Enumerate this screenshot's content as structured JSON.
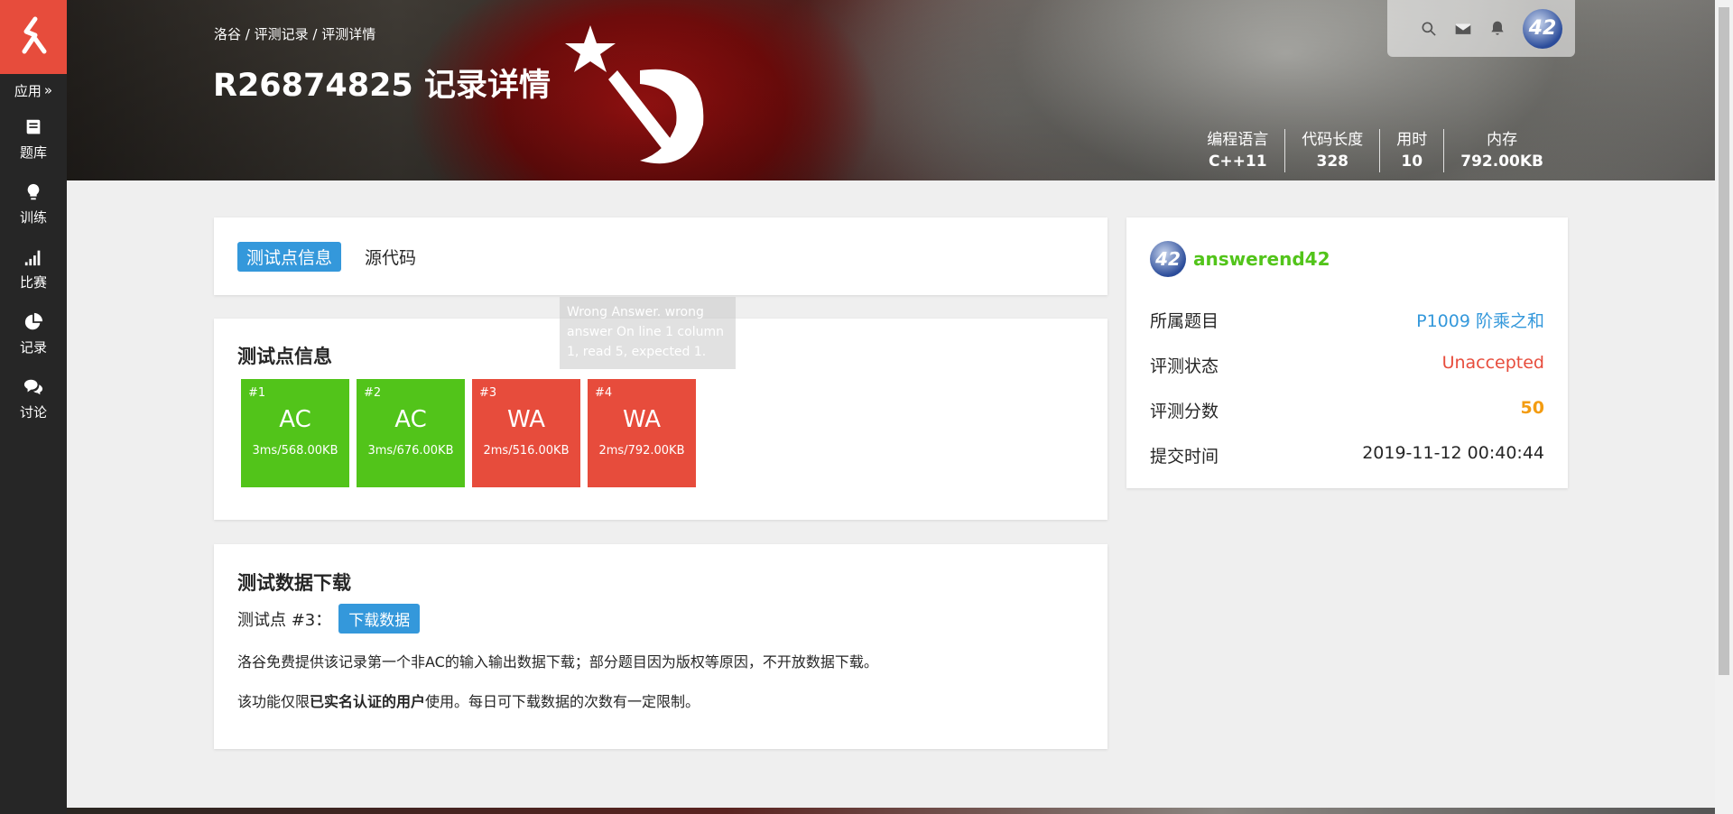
{
  "sidebar": {
    "apps_label": "应用",
    "items": [
      {
        "label": "题库",
        "icon": "book-icon"
      },
      {
        "label": "训练",
        "icon": "lightbulb-icon"
      },
      {
        "label": "比赛",
        "icon": "signal-bars-icon"
      },
      {
        "label": "记录",
        "icon": "pie-chart-icon"
      },
      {
        "label": "讨论",
        "icon": "chat-bubbles-icon"
      }
    ]
  },
  "header": {
    "breadcrumb": [
      "洛谷",
      "评测记录",
      "评测详情"
    ],
    "title": "R26874825 记录详情",
    "stats": [
      {
        "label": "编程语言",
        "value": "C++11"
      },
      {
        "label": "代码长度",
        "value": "328"
      },
      {
        "label": "用时",
        "value": "10"
      },
      {
        "label": "内存",
        "value": "792.00KB"
      }
    ]
  },
  "tabs": [
    {
      "label": "测试点信息",
      "active": true
    },
    {
      "label": "源代码",
      "active": false
    }
  ],
  "tests": {
    "title": "测试点信息",
    "cases": [
      {
        "num": "#1",
        "status": "AC",
        "time_mem": "3ms/568.00KB"
      },
      {
        "num": "#2",
        "status": "AC",
        "time_mem": "3ms/676.00KB"
      },
      {
        "num": "#3",
        "status": "WA",
        "time_mem": "2ms/516.00KB"
      },
      {
        "num": "#4",
        "status": "WA",
        "time_mem": "2ms/792.00KB"
      }
    ],
    "tooltip": "Wrong Answer. wrong answer On line 1 column 1, read 5, expected 1."
  },
  "download": {
    "title": "测试数据下载",
    "case_label": "测试点 #3：",
    "button": "下载数据",
    "text1": "洛谷免费提供该记录第一个非AC的输入输出数据下载；部分题目因为版权等原因，不开放数据下载。",
    "text2_prefix": "该功能仅限",
    "text2_bold": "已实名认证的用户",
    "text2_suffix": "使用。每日可下载数据的次数有一定限制。"
  },
  "info": {
    "username": "answerend42",
    "avatar_text": "42",
    "rows": [
      {
        "key": "所属题目",
        "value": "P1009 阶乘之和"
      },
      {
        "key": "评测状态",
        "value": "Unaccepted"
      },
      {
        "key": "评测分数",
        "value": "50"
      },
      {
        "key": "提交时间",
        "value": "2019-11-12 00:40:44"
      }
    ]
  },
  "colors": {
    "brand_red": "#e74c3c",
    "ac_green": "#52c41a",
    "link_blue": "#3498db",
    "score_orange": "#f39c11",
    "sidebar_dark": "#262626"
  }
}
